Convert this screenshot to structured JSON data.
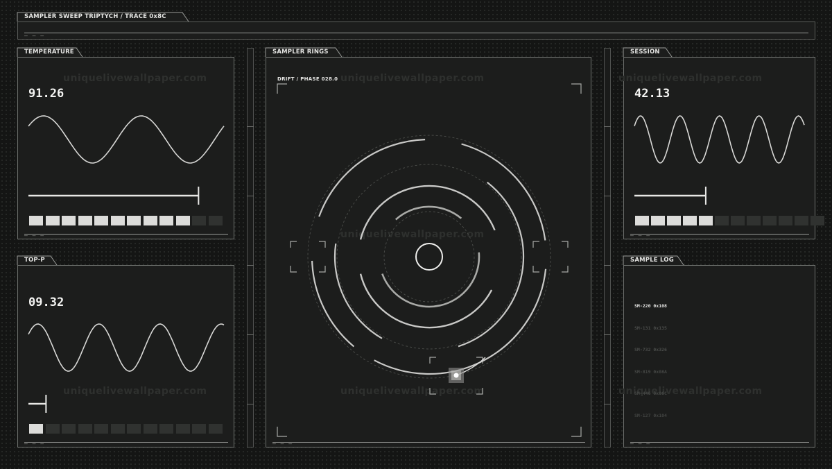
{
  "header": {
    "title": "SAMPLER SWEEP TRIPTYCH / TRACE 0x8C"
  },
  "watermark": "uniquelivewallpaper.com",
  "temperature": {
    "label": "TEMPERATURE",
    "value": "91.26",
    "level": 0.87,
    "chips_on": 10,
    "chips_total": 12
  },
  "top_p": {
    "label": "TOP-P",
    "value": "09.32",
    "level": 0.09,
    "chips_on": 1,
    "chips_total": 12
  },
  "rings": {
    "label": "SAMPLER RINGS",
    "drift": "DRIFT / PHASE 028.0"
  },
  "session": {
    "label": "SESSION",
    "value": "42.13",
    "level": 0.42,
    "chips_on": 5,
    "chips_total": 12
  },
  "log": {
    "label": "SAMPLE LOG",
    "entries": [
      {
        "text": "SM-220 0x108",
        "color": "#e6e6e4"
      },
      {
        "text": "SM-131 0x135",
        "color": "#4a4c4a"
      },
      {
        "text": "SM-732 0x326",
        "color": "#4a4c4a"
      },
      {
        "text": "SM-819 0x08A",
        "color": "#464846"
      },
      {
        "text": "SM-446 0x06C",
        "color": "#464846"
      },
      {
        "text": "SM-127 0x104",
        "color": "#424442"
      }
    ]
  },
  "footer_dash": "— — —",
  "colors": {
    "panel_bg": "#1c1d1c",
    "border": "#6f726f",
    "accent": "#e6e6e4",
    "chip_off": "#303230"
  }
}
